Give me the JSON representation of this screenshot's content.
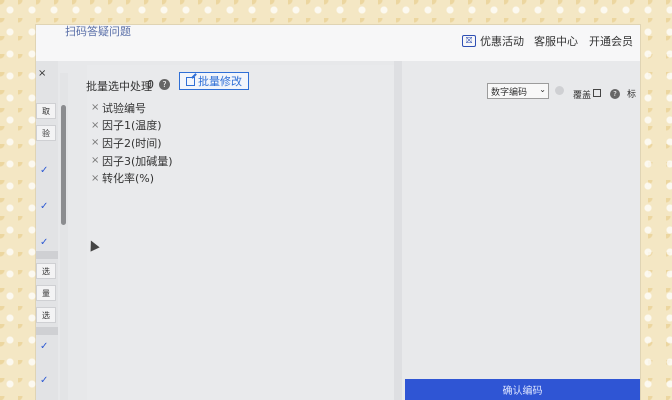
{
  "header": {
    "top_link": "扫码答疑问题",
    "promo_icon": "⛝",
    "promo": "优惠活动",
    "service": "客服中心",
    "member": "开通会员"
  },
  "sidebar": {
    "close": "×",
    "check1": "✓",
    "check2": "✓",
    "check3": "✓",
    "check4": "✓",
    "check5": "✓",
    "btn1": "取",
    "btn2": "验",
    "btn3": "选",
    "btn4": "量",
    "btn5": "选"
  },
  "batch": {
    "label": "批量选中处理",
    "count": "0",
    "help": "?",
    "button_label": "批量修改"
  },
  "fields": [
    {
      "label": "试验编号"
    },
    {
      "label": "因子1(温度)"
    },
    {
      "label": "因子2(时间)"
    },
    {
      "label": "因子3(加碱量)"
    },
    {
      "label": "转化率(%)"
    }
  ],
  "remove_glyph": "×",
  "right": {
    "encode_select": "数字编码",
    "chevron": "⌄",
    "cover_label": "覆盖",
    "help": "?",
    "cut_text": "标"
  },
  "confirm_label": "确认编码"
}
